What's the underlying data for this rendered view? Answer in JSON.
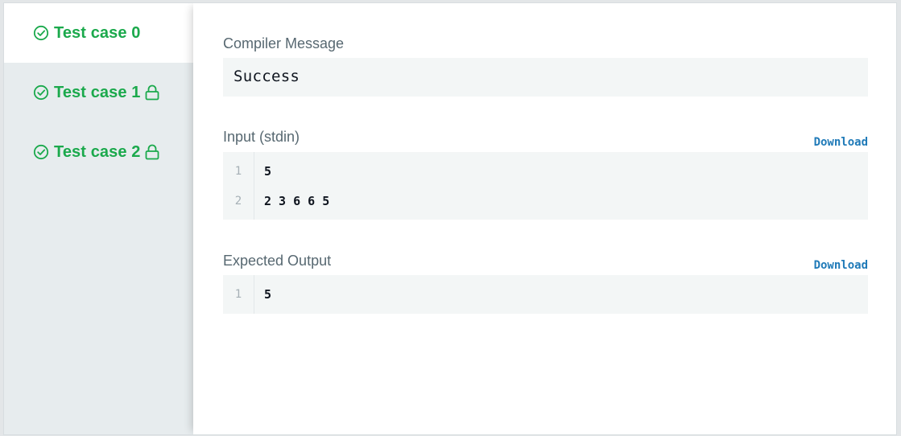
{
  "tabs": [
    {
      "label": "Test case 0",
      "locked": false,
      "active": true
    },
    {
      "label": "Test case 1",
      "locked": true,
      "active": false
    },
    {
      "label": "Test case 2",
      "locked": true,
      "active": false
    }
  ],
  "compiler": {
    "title": "Compiler Message",
    "message": "Success"
  },
  "input": {
    "title": "Input (stdin)",
    "download_label": "Download",
    "lines": [
      {
        "num": "1",
        "text": "5"
      },
      {
        "num": "2",
        "text": "2 3 6 6 5"
      }
    ]
  },
  "expected": {
    "title": "Expected Output",
    "download_label": "Download",
    "lines": [
      {
        "num": "1",
        "text": "5"
      }
    ]
  },
  "colors": {
    "success_green": "#1ba94c",
    "link_blue": "#1f7ab8",
    "code_bg": "#f3f6f6"
  },
  "icons": {
    "check": "check-circle-icon",
    "lock": "lock-icon"
  }
}
